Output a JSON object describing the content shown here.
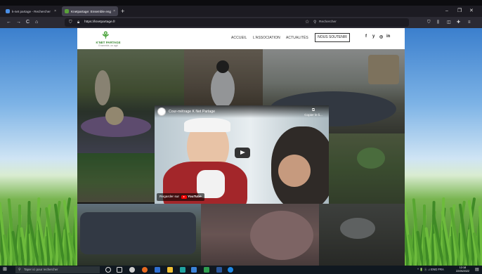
{
  "browser": {
    "tabs": [
      {
        "label": "k-net partage - Rechercher",
        "close": "×"
      },
      {
        "label": "Knetpartage: Ensemble engagés",
        "close": "×"
      }
    ],
    "new_tab": "+",
    "window_controls": [
      "–",
      "❐",
      "✕"
    ],
    "nav": {
      "back": "←",
      "forward": "→",
      "reload": "C",
      "home": "⌂"
    },
    "url": "https://knetpartage.fr",
    "search_placeholder": "Rechercher",
    "toolbar_icons": [
      "shield-icon",
      "library-icon",
      "sidebar-icon",
      "extensions-icon",
      "menu-icon"
    ]
  },
  "site": {
    "logo_name": "K'NET PARTAGE",
    "logo_tag": "Ensemble, on agit",
    "menu": [
      "ACCUEIL",
      "L'ASSOCIATION",
      "ACTUALITÉS"
    ],
    "cta": "NOUS SOUTENIR",
    "social": [
      "f",
      "y",
      "◎",
      "in"
    ]
  },
  "video": {
    "title": "Cour-métrage K Net Partage",
    "copy_label": "Copier le li...",
    "watch_label": "Regarder sur",
    "youtube_label": "YouTube"
  },
  "taskbar": {
    "search_placeholder": "Taper ici pour rechercher",
    "tray_text": "^ 🔋 ⓔ ♫ ENG FRA",
    "time": "12:18",
    "date": "22/05/2022"
  },
  "colors": {
    "brand_green": "#52a844",
    "youtube_red": "#ff0000",
    "browser_dark": "#1c1b22"
  }
}
